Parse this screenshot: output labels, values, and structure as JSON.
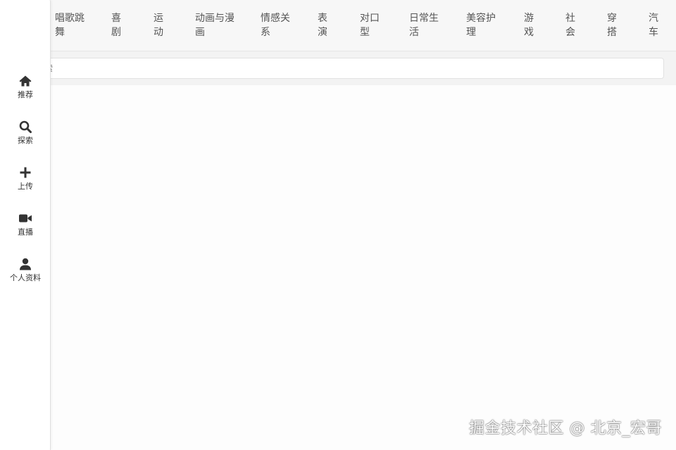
{
  "categories": [
    {
      "label": "唱歌跳舞"
    },
    {
      "label": "喜剧"
    },
    {
      "label": "运动"
    },
    {
      "label": "动画与漫画"
    },
    {
      "label": "情感关系"
    },
    {
      "label": "表演"
    },
    {
      "label": "对口型"
    },
    {
      "label": "日常生活"
    },
    {
      "label": "美容护理"
    },
    {
      "label": "游戏"
    },
    {
      "label": "社会"
    },
    {
      "label": "穿搭"
    },
    {
      "label": "汽车"
    }
  ],
  "search": {
    "placeholder": "搜索"
  },
  "sidebar": {
    "items": [
      {
        "label": "推荐",
        "icon": "home-icon"
      },
      {
        "label": "探索",
        "icon": "search-icon"
      },
      {
        "label": "上传",
        "icon": "plus-icon"
      },
      {
        "label": "直播",
        "icon": "video-camera-icon"
      },
      {
        "label": "个人资料",
        "icon": "user-icon"
      }
    ]
  },
  "watermark": "掘金技术社区 @ 北京_宏哥",
  "colors": {
    "sidebar_bg": "#ffffff",
    "topbar_bg": "#f7f7f7",
    "icon": "#333333",
    "text": "#555555"
  }
}
